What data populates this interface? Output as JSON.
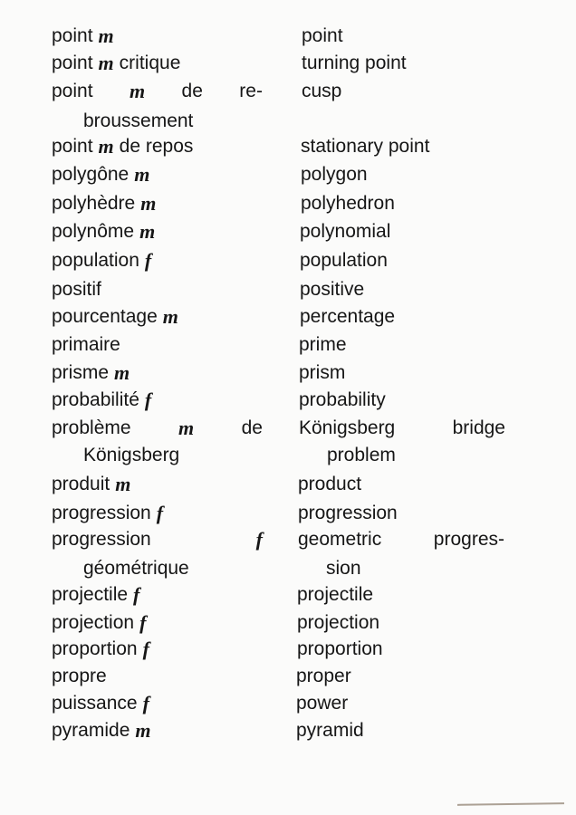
{
  "entries": [
    {
      "fr": [
        [
          {
            "t": "point"
          },
          {
            "t": "m",
            "i": true
          }
        ]
      ],
      "en": [
        [
          "point"
        ]
      ]
    },
    {
      "fr": [
        [
          {
            "t": "point"
          },
          {
            "t": "m",
            "i": true
          },
          {
            "t": "critique"
          }
        ]
      ],
      "en": [
        [
          "turning point"
        ]
      ]
    },
    {
      "fr": [
        [
          {
            "t": "point"
          },
          {
            "t": "m",
            "i": true
          },
          {
            "t": "de"
          },
          {
            "t": "re-"
          }
        ],
        [
          {
            "t": "broussement"
          }
        ]
      ],
      "en": [
        [
          "cusp"
        ]
      ],
      "fr_spread": true
    },
    {
      "fr": [
        [
          {
            "t": "point"
          },
          {
            "t": "m",
            "i": true
          },
          {
            "t": "de repos"
          }
        ]
      ],
      "en": [
        [
          "stationary point"
        ]
      ]
    },
    {
      "fr": [
        [
          {
            "t": "polygône"
          },
          {
            "t": "m",
            "i": true
          }
        ]
      ],
      "en": [
        [
          "polygon"
        ]
      ]
    },
    {
      "fr": [
        [
          {
            "t": "polyhèdre"
          },
          {
            "t": "m",
            "i": true
          }
        ]
      ],
      "en": [
        [
          "polyhedron"
        ]
      ]
    },
    {
      "fr": [
        [
          {
            "t": "polynôme"
          },
          {
            "t": "m",
            "i": true
          }
        ]
      ],
      "en": [
        [
          "polynomial"
        ]
      ]
    },
    {
      "fr": [
        [
          {
            "t": "population"
          },
          {
            "t": "f",
            "i": true
          }
        ]
      ],
      "en": [
        [
          "population"
        ]
      ]
    },
    {
      "fr": [
        [
          {
            "t": "positif"
          }
        ]
      ],
      "en": [
        [
          "positive"
        ]
      ]
    },
    {
      "fr": [
        [
          {
            "t": "pourcentage"
          },
          {
            "t": "m",
            "i": true
          }
        ]
      ],
      "en": [
        [
          "percentage"
        ]
      ]
    },
    {
      "fr": [
        [
          {
            "t": "primaire"
          }
        ]
      ],
      "en": [
        [
          "prime"
        ]
      ]
    },
    {
      "fr": [
        [
          {
            "t": "prisme"
          },
          {
            "t": "m",
            "i": true
          }
        ]
      ],
      "en": [
        [
          "prism"
        ]
      ]
    },
    {
      "fr": [
        [
          {
            "t": "probabilité"
          },
          {
            "t": "f",
            "i": true
          }
        ]
      ],
      "en": [
        [
          "probability"
        ]
      ]
    },
    {
      "fr": [
        [
          {
            "t": "problème"
          },
          {
            "t": "m",
            "i": true
          },
          {
            "t": "de"
          }
        ],
        [
          {
            "t": "Königsberg"
          }
        ]
      ],
      "en": [
        [
          "Königsberg",
          "bridge"
        ],
        [
          "problem"
        ]
      ],
      "fr_spread": true,
      "en_spread": true
    },
    {
      "fr": [
        [
          {
            "t": "produit"
          },
          {
            "t": "m",
            "i": true
          }
        ]
      ],
      "en": [
        [
          "product"
        ]
      ]
    },
    {
      "fr": [
        [
          {
            "t": "progression"
          },
          {
            "t": "f",
            "i": true
          }
        ]
      ],
      "en": [
        [
          "progression"
        ]
      ]
    },
    {
      "fr": [
        [
          {
            "t": "progression"
          },
          {
            "t": "f",
            "i": true
          }
        ],
        [
          {
            "t": "géométrique"
          }
        ]
      ],
      "en": [
        [
          "geometric",
          "progres-"
        ],
        [
          "sion"
        ]
      ],
      "fr_spread": true,
      "en_spread": true
    },
    {
      "fr": [
        [
          {
            "t": "projectile"
          },
          {
            "t": "f",
            "i": true
          }
        ]
      ],
      "en": [
        [
          "projectile"
        ]
      ]
    },
    {
      "fr": [
        [
          {
            "t": "projection"
          },
          {
            "t": "f",
            "i": true
          }
        ]
      ],
      "en": [
        [
          "projection"
        ]
      ]
    },
    {
      "fr": [
        [
          {
            "t": "proportion"
          },
          {
            "t": "f",
            "i": true
          }
        ]
      ],
      "en": [
        [
          "proportion"
        ]
      ]
    },
    {
      "fr": [
        [
          {
            "t": "propre"
          }
        ]
      ],
      "en": [
        [
          "proper"
        ]
      ]
    },
    {
      "fr": [
        [
          {
            "t": "puissance"
          },
          {
            "t": "f",
            "i": true
          }
        ]
      ],
      "en": [
        [
          "power"
        ]
      ]
    },
    {
      "fr": [
        [
          {
            "t": "pyramide"
          },
          {
            "t": "m",
            "i": true
          }
        ]
      ],
      "en": [
        [
          "pyramid"
        ]
      ]
    }
  ]
}
